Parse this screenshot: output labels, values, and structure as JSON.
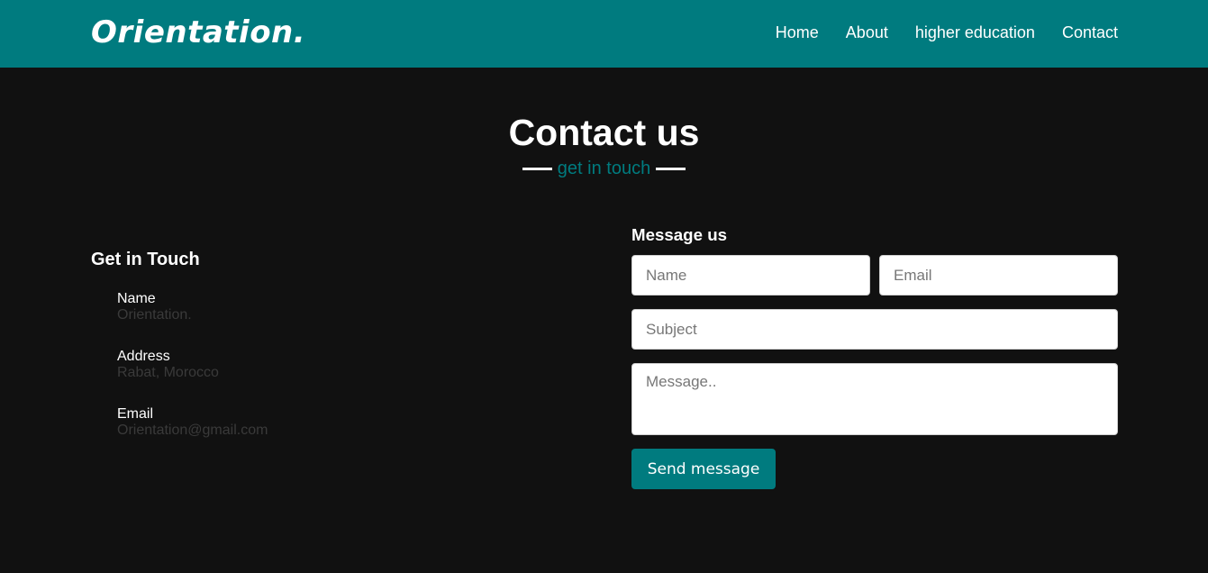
{
  "nav": {
    "logo": "Orientation.",
    "links": [
      "Home",
      "About",
      "higher education",
      "Contact"
    ]
  },
  "hero": {
    "title": "Contact us",
    "subtitle": "get in touch"
  },
  "info": {
    "heading": "Get in Touch",
    "items": [
      {
        "label": "Name",
        "value": "Orientation."
      },
      {
        "label": "Address",
        "value": "Rabat, Morocco"
      },
      {
        "label": "Email",
        "value": "Orientation@gmail.com"
      }
    ]
  },
  "form": {
    "heading": "Message us",
    "name_placeholder": "Name",
    "email_placeholder": "Email",
    "subject_placeholder": "Subject",
    "message_placeholder": "Message..",
    "send_label": "Send message"
  },
  "colors": {
    "brand": "#007b7f",
    "background": "#111111"
  }
}
